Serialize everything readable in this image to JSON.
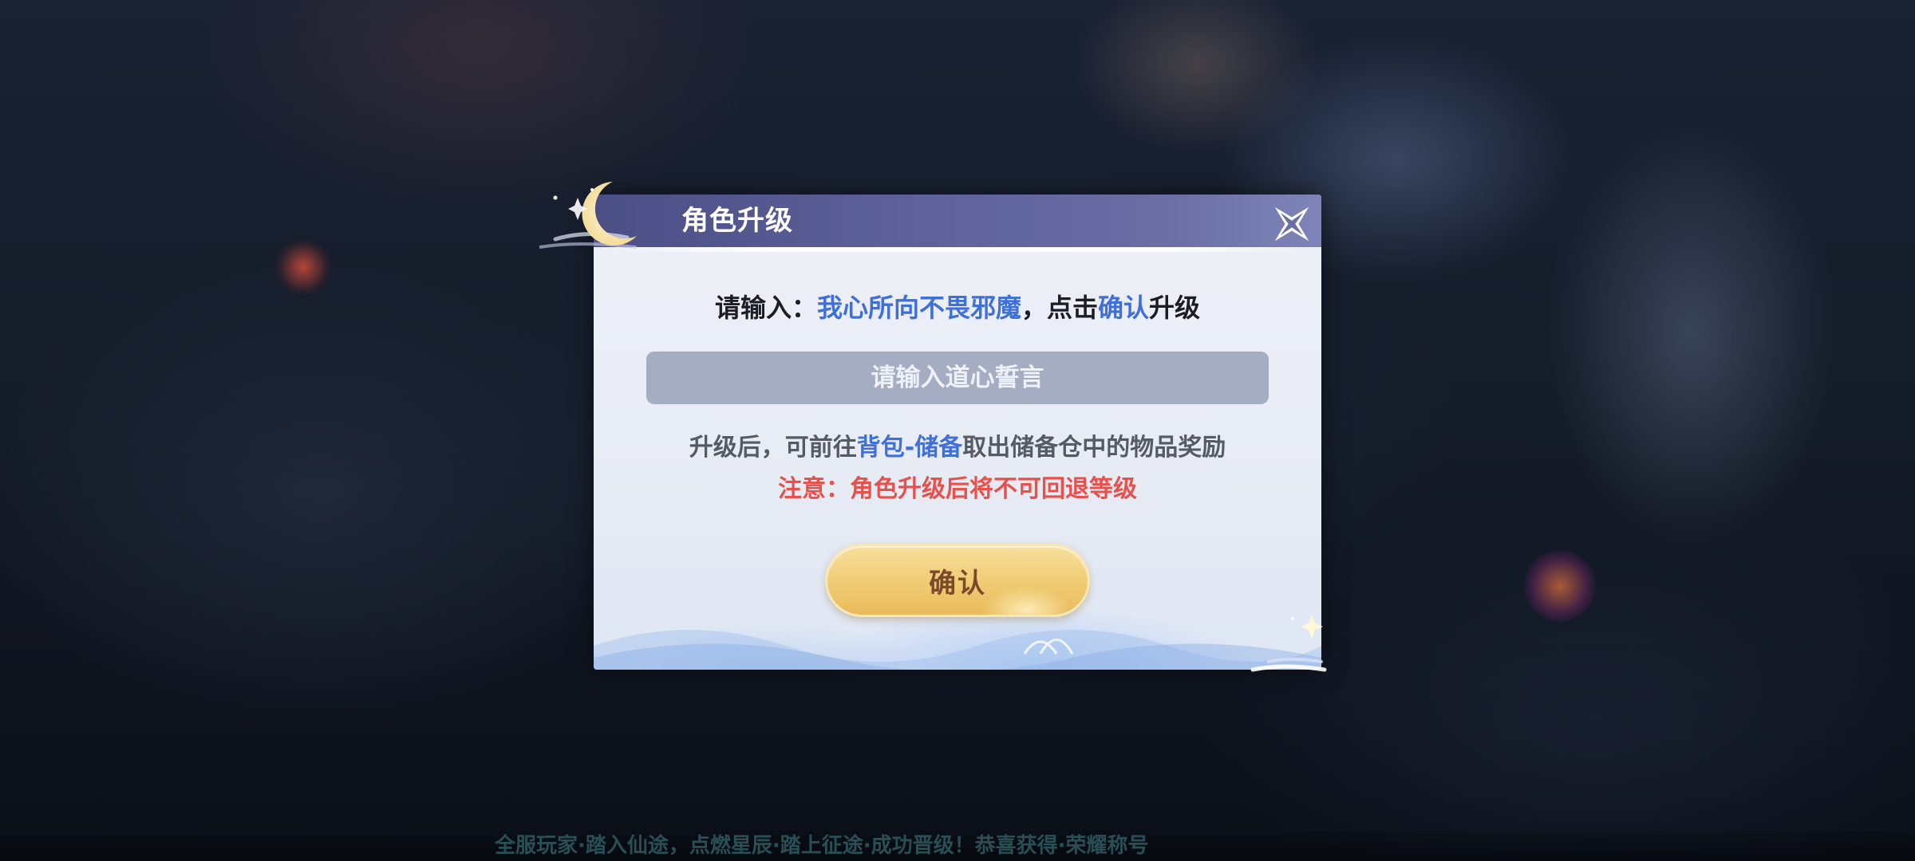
{
  "dialog": {
    "title": "角色升级",
    "instruction": {
      "prefix": "请输入：",
      "phrase": "我心所向不畏邪魔",
      "middle": "，点击",
      "action": "确认",
      "suffix": "升级"
    },
    "input": {
      "placeholder": "请输入道心誓言",
      "value": ""
    },
    "info": {
      "prefix": "升级后，可前往",
      "location": "背包-储备",
      "suffix": "取出储备仓中的物品奖励"
    },
    "warning": "注意：角色升级后将不可回退等级",
    "confirm_label": "确认"
  },
  "background": {
    "ticker_text": "全服玩家·踏入仙途，点燃星辰·踏上征途·成功晋级！恭喜获得·荣耀称号"
  },
  "colors": {
    "header": "#5c5f98",
    "highlight_blue": "#3f6fd8",
    "warning_red": "#e8504c",
    "input_bg": "#a4adc2",
    "button_gold": "#f0cb73",
    "button_text": "#7a4a2a"
  },
  "icons": {
    "close": "close-x-icon",
    "moon": "crescent-moon-icon",
    "sparkle": "sparkle-icon"
  }
}
